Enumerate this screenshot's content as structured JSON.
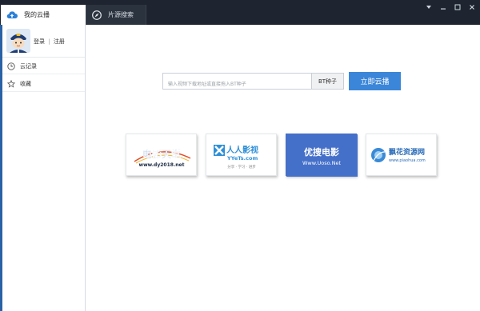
{
  "tabs": [
    {
      "label": "我的云播",
      "icon": "cloud-upload-icon"
    },
    {
      "label": "片源搜索",
      "icon": "compass-icon"
    }
  ],
  "window_controls": [
    "menu-dropdown-icon",
    "minimize-icon",
    "maximize-icon",
    "close-icon"
  ],
  "user": {
    "login": "登录",
    "separator": "|",
    "register": "注册"
  },
  "sidebar": {
    "items": [
      {
        "label": "云记录",
        "icon": "clock-icon"
      },
      {
        "label": "收藏",
        "icon": "star-icon"
      }
    ]
  },
  "search": {
    "placeholder": "输入视频下载地址或直接拖入BT种子",
    "bt_label": "BT种子",
    "play_label": "立即云播"
  },
  "sites": [
    {
      "title": "电影天堂",
      "url": "www.dy2018.net"
    },
    {
      "title": "人人影视",
      "url": "YYeTs.com",
      "slogan": "分享 · 学习 · 进步"
    },
    {
      "title": "优搜电影",
      "url": "Www.Uoso.Net"
    },
    {
      "title": "飘花资源网",
      "url": "www.piaohua.com"
    }
  ],
  "colors": {
    "topbar": "#1e2530",
    "accent": "#3b86d8",
    "sidebar_strip": "#2a62a5"
  }
}
